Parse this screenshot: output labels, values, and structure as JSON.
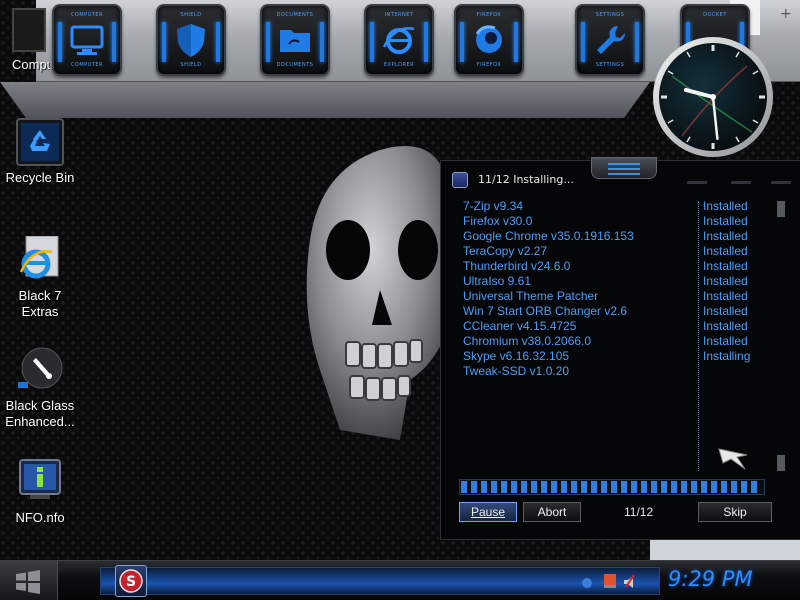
{
  "desktop": {
    "icons": [
      {
        "label": "Compu",
        "icon": "computer-icon"
      },
      {
        "label": "Recycle Bin",
        "icon": "recycle-bin-icon"
      },
      {
        "label": "Black 7\nExtras",
        "line1": "Black 7",
        "line2": "Extras",
        "icon": "internet-explorer-icon"
      },
      {
        "label": "Black Glass Enhanced...",
        "line1": "Black Glass",
        "line2": "Enhanced...",
        "icon": "paintbrush-icon"
      },
      {
        "label": "NFO.nfo",
        "icon": "info-document-icon"
      }
    ]
  },
  "dock": {
    "items": [
      {
        "caption": "COMPUTER",
        "icon": "monitor-icon"
      },
      {
        "caption": "SHIELD",
        "icon": "shield-icon"
      },
      {
        "caption": "DOCUMENTS",
        "icon": "folder-icon"
      },
      {
        "caption": "INTERNET EXPLORER",
        "top": "INTERNET",
        "bottom": "EXPLORER",
        "icon": "internet-explorer-icon"
      },
      {
        "caption": "FIREFOX",
        "icon": "firefox-icon"
      },
      {
        "caption": "SETTINGS",
        "icon": "wrench-icon"
      },
      {
        "caption": "DOCKET",
        "icon": "dock-icon"
      }
    ],
    "plus": "+"
  },
  "installer": {
    "title": "11/12 Installing...",
    "items": [
      {
        "name": "7-Zip v9.34",
        "status": "Installed"
      },
      {
        "name": "Firefox v30.0",
        "status": "Installed"
      },
      {
        "name": "Google Chrome v35.0.1916.153",
        "status": "Installed"
      },
      {
        "name": "TeraCopy v2.27",
        "status": "Installed"
      },
      {
        "name": "Thunderbird v24.6.0",
        "status": "Installed"
      },
      {
        "name": "UltraIso 9.61",
        "status": "Installed"
      },
      {
        "name": "Universal Theme Patcher",
        "status": "Installed"
      },
      {
        "name": "Win 7 Start ORB Changer v2.6",
        "status": "Installed"
      },
      {
        "name": "CCleaner v4.15.4725",
        "status": "Installed"
      },
      {
        "name": "Chromium v38.0.2066.0",
        "status": "Installed"
      },
      {
        "name": "Skype v6.16.32.105",
        "status": "Installing"
      },
      {
        "name": "Tweak-SSD v1.0.20",
        "status": ""
      }
    ],
    "progress": 0.98,
    "buttons": {
      "pause": "Pause",
      "abort": "Abort",
      "skip": "Skip"
    },
    "counter": "11/12"
  },
  "clock": {
    "hour": 9,
    "minute": 29
  },
  "taskbar": {
    "time": "9:29 PM",
    "start_icon": "windows-logo-icon",
    "task_icon": "s-app-icon",
    "tray_icons": [
      "network-icon",
      "flag-icon",
      "volume-icon"
    ]
  },
  "colors": {
    "accent": "#2f8cff",
    "list_text": "#4d9ef7",
    "window_bg": "#050607"
  }
}
